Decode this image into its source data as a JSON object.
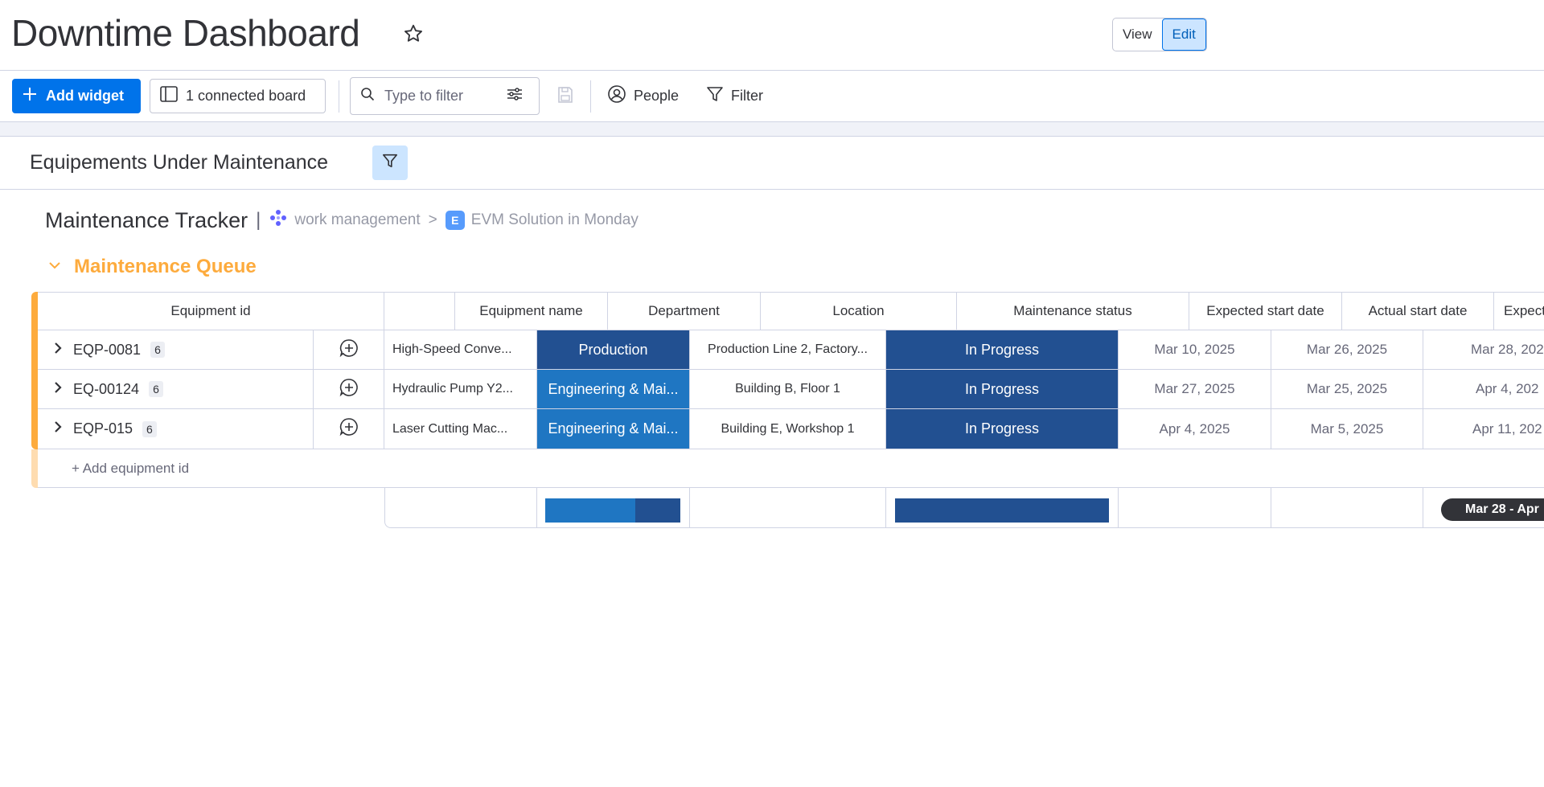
{
  "header": {
    "title": "Downtime Dashboard",
    "view_label": "View",
    "edit_label": "Edit"
  },
  "toolbar": {
    "add_widget_label": "Add widget",
    "connected_boards_label": "1 connected board",
    "filter_placeholder": "Type to filter",
    "people_label": "People",
    "filter_label": "Filter"
  },
  "widget": {
    "title": "Equipements Under Maintenance"
  },
  "breadcrumb": {
    "board_name": "Maintenance Tracker",
    "separator": "|",
    "workspace": "work management",
    "chevron": ">",
    "board_badge": "E",
    "board": "EVM Solution in Monday"
  },
  "group": {
    "title": "Maintenance Queue",
    "color": "#fdab3d"
  },
  "table": {
    "columns": {
      "equipment_id": "Equipment id",
      "equipment_name": "Equipment name",
      "department": "Department",
      "location": "Location",
      "maintenance_status": "Maintenance status",
      "expected_start": "Expected start date",
      "actual_start": "Actual start date",
      "expected_end": "Expected end"
    },
    "rows": [
      {
        "id": "EQP-0081",
        "count": "6",
        "name": "High-Speed Conve...",
        "department": "Production",
        "department_color": "#225091",
        "location": "Production Line 2, Factory...",
        "status": "In Progress",
        "status_color": "#225091",
        "expected_start": "Mar 10, 2025",
        "actual_start": "Mar 26, 2025",
        "expected_end": "Mar 28, 202"
      },
      {
        "id": "EQ-00124",
        "count": "6",
        "name": "Hydraulic Pump Y2...",
        "department": "Engineering & Mai...",
        "department_color": "#1f76c2",
        "location": "Building B, Floor 1",
        "status": "In Progress",
        "status_color": "#225091",
        "expected_start": "Mar 27, 2025",
        "actual_start": "Mar 25, 2025",
        "expected_end": "Apr 4, 202"
      },
      {
        "id": "EQP-015",
        "count": "6",
        "name": "Laser Cutting Mac...",
        "department": "Engineering & Mai...",
        "department_color": "#1f76c2",
        "location": "Building E, Workshop 1",
        "status": "In Progress",
        "status_color": "#225091",
        "expected_start": "Apr 4, 2025",
        "actual_start": "Mar 5, 2025",
        "expected_end": "Apr 11, 202"
      }
    ],
    "add_row_label": "+ Add equipment id",
    "summary": {
      "department_fraction_light": 0.667,
      "department_fraction_dark": 0.333,
      "status_fraction": 1.0,
      "timeline_label": "Mar 28 - Apr"
    }
  }
}
